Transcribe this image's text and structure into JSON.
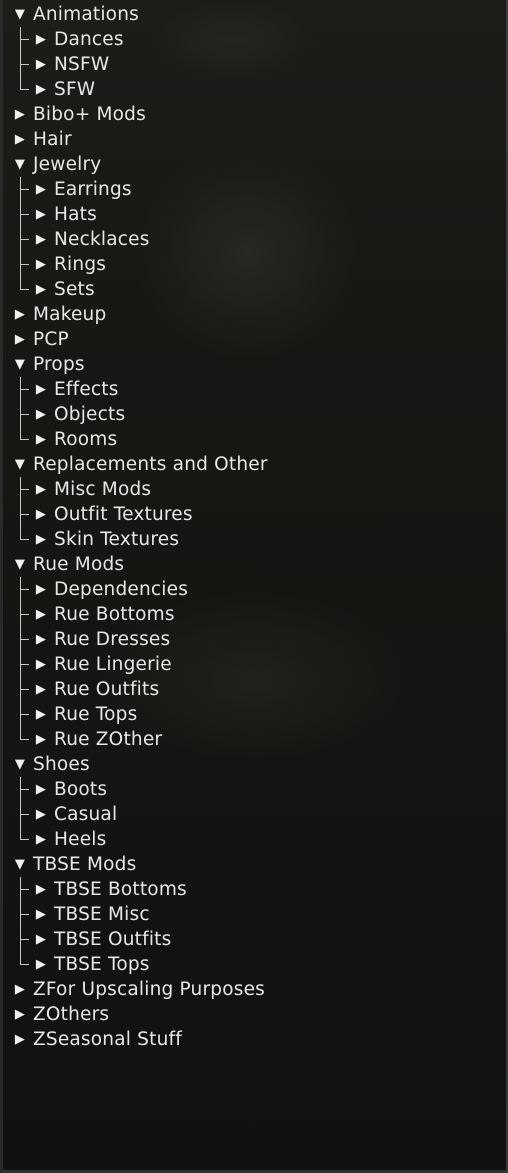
{
  "tree": [
    {
      "label": "Animations",
      "expanded": true,
      "children": [
        "Dances",
        "NSFW",
        "SFW"
      ]
    },
    {
      "label": "Bibo+ Mods",
      "expanded": false,
      "children": []
    },
    {
      "label": "Hair",
      "expanded": false,
      "children": []
    },
    {
      "label": "Jewelry",
      "expanded": true,
      "children": [
        "Earrings",
        "Hats",
        "Necklaces",
        "Rings",
        "Sets"
      ]
    },
    {
      "label": "Makeup",
      "expanded": false,
      "children": []
    },
    {
      "label": "PCP",
      "expanded": false,
      "children": []
    },
    {
      "label": "Props",
      "expanded": true,
      "children": [
        "Effects",
        "Objects",
        "Rooms"
      ]
    },
    {
      "label": "Replacements and Other",
      "expanded": true,
      "children": [
        "Misc Mods",
        "Outfit Textures",
        "Skin Textures"
      ]
    },
    {
      "label": "Rue Mods",
      "expanded": true,
      "children": [
        "Dependencies",
        "Rue Bottoms",
        "Rue Dresses",
        "Rue Lingerie",
        "Rue Outfits",
        "Rue Tops",
        "Rue ZOther"
      ]
    },
    {
      "label": "Shoes",
      "expanded": true,
      "children": [
        "Boots",
        "Casual",
        "Heels"
      ]
    },
    {
      "label": "TBSE Mods",
      "expanded": true,
      "children": [
        "TBSE Bottoms",
        "TBSE Misc",
        "TBSE Outfits",
        "TBSE Tops"
      ]
    },
    {
      "label": "ZFor Upscaling Purposes",
      "expanded": false,
      "children": []
    },
    {
      "label": "ZOthers",
      "expanded": false,
      "children": []
    },
    {
      "label": "ZSeasonal Stuff",
      "expanded": false,
      "children": []
    }
  ],
  "icons": {
    "expanded": "▼",
    "collapsed": "▶"
  }
}
